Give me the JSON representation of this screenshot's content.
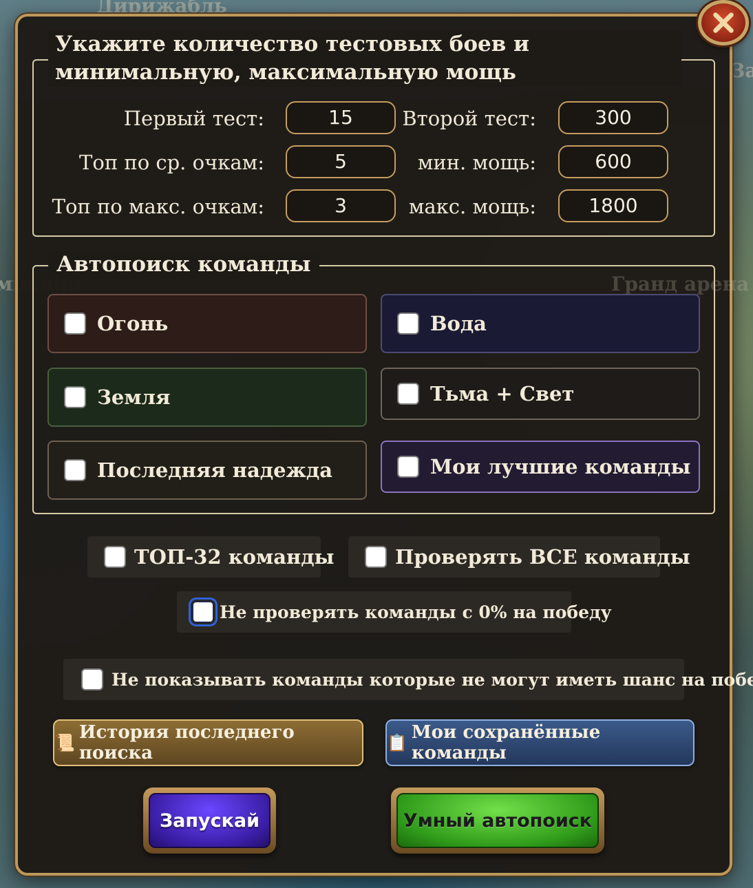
{
  "background": {
    "label_top": "Дирижабль",
    "label_left": "мпания",
    "label_right": "За",
    "label_grand": "Гранд арена"
  },
  "dialog": {
    "close_icon": "close-x-icon",
    "section1": {
      "title": "Укажите количество тестовых боев и минимальную, максимальную мощь",
      "fields": [
        {
          "label": "Первый тест:",
          "value": "15"
        },
        {
          "label": "Второй тест:",
          "value": "300"
        },
        {
          "label": "Топ по ср. очкам:",
          "value": "5"
        },
        {
          "label": "мин. мощь:",
          "value": "600"
        },
        {
          "label": "Топ по макс. очкам:",
          "value": "3"
        },
        {
          "label": "макс. мощь:",
          "value": "1800"
        }
      ]
    },
    "section2": {
      "title": "Автопоиск команды",
      "teams": [
        {
          "label": "Огонь",
          "checked": false
        },
        {
          "label": "Вода",
          "checked": false
        },
        {
          "label": "Земля",
          "checked": false
        },
        {
          "label": "Тьма + Свет",
          "checked": false
        },
        {
          "label": "Последняя надежда",
          "checked": false
        },
        {
          "label": "Мои лучшие команды",
          "checked": false
        }
      ]
    },
    "options": {
      "top32": "ТОП-32 команды",
      "check_all": "Проверять ВСЕ команды",
      "skip_zero": "Не проверять команды с 0% на победу",
      "hide_no_chance": "Не показывать команды которые не могут иметь шанс на победу"
    },
    "buttons": {
      "history_icon": "📜",
      "history": "История последнего поиска",
      "saved_icon": "📋",
      "saved": "Мои сохранённые команды",
      "start": "Запускай",
      "smart": "Умный автопоиск"
    }
  }
}
